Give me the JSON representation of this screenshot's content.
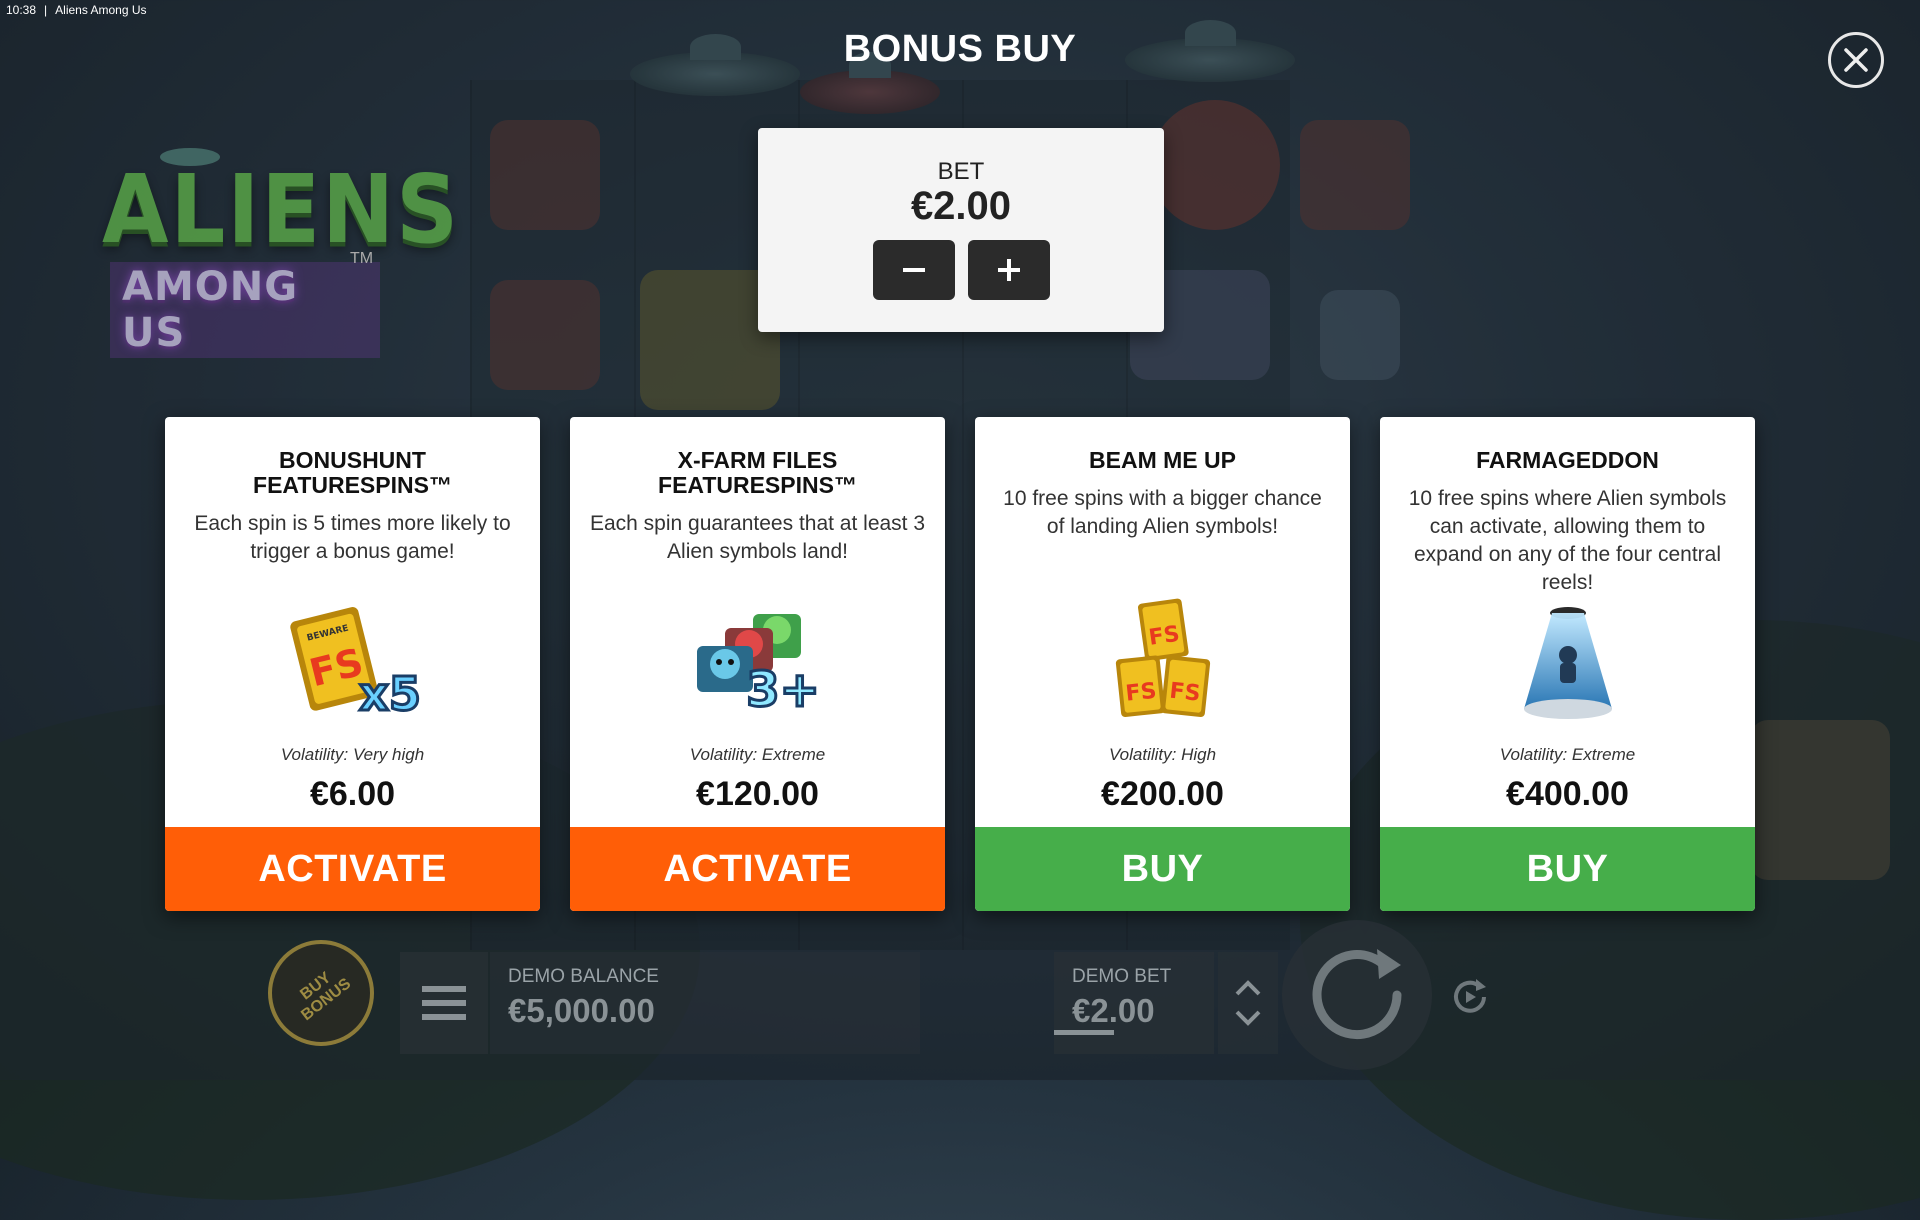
{
  "window": {
    "time": "10:38",
    "separator": "|",
    "title": "Aliens Among Us"
  },
  "logo": {
    "main": "ALIENS",
    "sub": "AMONG US",
    "tm": "TM"
  },
  "header": {
    "title": "BONUS BUY"
  },
  "bet_panel": {
    "label": "BET",
    "value": "€2.00"
  },
  "cards": [
    {
      "title": "BONUSHUNT FEATURESPINS™",
      "description": "Each spin is 5 times more likely to trigger a bonus game!",
      "art_badge": "x5",
      "volatility": "Volatility: Very high",
      "price": "€6.00",
      "button": "ACTIVATE",
      "button_color": "#ff5e07"
    },
    {
      "title": "X-FARM FILES FEATURESPINS™",
      "description": "Each spin guarantees that at least 3 Alien symbols land!",
      "art_badge": "3+",
      "volatility": "Volatility: Extreme",
      "price": "€120.00",
      "button": "ACTIVATE",
      "button_color": "#ff5e07"
    },
    {
      "title": "BEAM ME UP",
      "description": "10 free spins with a bigger chance of landing Alien symbols!",
      "art_badge": "",
      "volatility": "Volatility: High",
      "price": "€200.00",
      "button": "BUY",
      "button_color": "#46ae4a"
    },
    {
      "title": "FARMAGEDDON",
      "description": "10 free spins where Alien symbols can activate, allowing them to expand on any of the four central reels!",
      "art_badge": "",
      "volatility": "Volatility: Extreme",
      "price": "€400.00",
      "button": "BUY",
      "button_color": "#46ae4a"
    }
  ],
  "bottom": {
    "buy_bonus": "BUY BONUS",
    "balance_label": "DEMO BALANCE",
    "balance_value": "€5,000.00",
    "bet_label": "DEMO BET",
    "bet_value": "€2.00"
  },
  "card_art_text": {
    "beware": "BEWARE",
    "fs": "FS"
  }
}
